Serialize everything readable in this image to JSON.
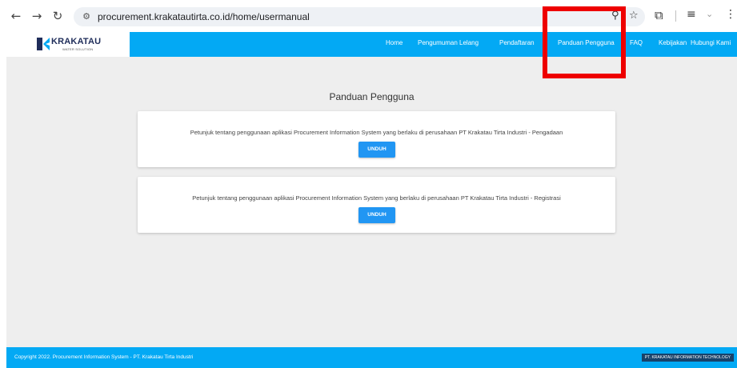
{
  "browser": {
    "url": "procurement.krakatautirta.co.id/home/usermanual",
    "icons": {
      "back": "back-arrow-icon",
      "forward": "forward-arrow-icon",
      "reload": "reload-icon",
      "site_info": "site-settings-icon",
      "zoom": "zoom-icon",
      "bookmark": "star-icon",
      "extensions": "puzzle-icon",
      "queue": "reading-list-icon",
      "download": "chevron-down-icon",
      "menu": "kebab-menu-icon"
    }
  },
  "header": {
    "logo_text": "KRAKATAU",
    "logo_subtitle": "WATER SOLUTION",
    "nav": [
      {
        "label": "Home"
      },
      {
        "label": "Pengumuman Lelang"
      },
      {
        "label": "Pendaftaran"
      },
      {
        "label": "Panduan Pengguna"
      },
      {
        "label": "FAQ"
      },
      {
        "label": "Kebijakan"
      },
      {
        "label": "Hubungi Kami"
      }
    ]
  },
  "main": {
    "title": "Panduan Pengguna",
    "cards": [
      {
        "text": "Petunjuk tentang penggunaan aplikasi Procurement Information System yang berlaku di perusahaan PT Krakatau Tirta Industri - Pengadaan",
        "button_label": "UNDUH"
      },
      {
        "text": "Petunjuk tentang penggunaan aplikasi Procurement Information System yang berlaku di perusahaan PT Krakatau Tirta Industri - Registrasi",
        "button_label": "UNDUH"
      }
    ]
  },
  "footer": {
    "copyright": "Copyright 2022. Procurement Information System - PT. Krakatau Tirta Industri",
    "badge": "PT. KRAKATAU INFORMATION TECHNOLOGY"
  },
  "colors": {
    "brand_blue": "#03a9f4",
    "button_blue": "#2196f3",
    "highlight_red": "#ee0000",
    "footer_badge": "#17426b"
  }
}
